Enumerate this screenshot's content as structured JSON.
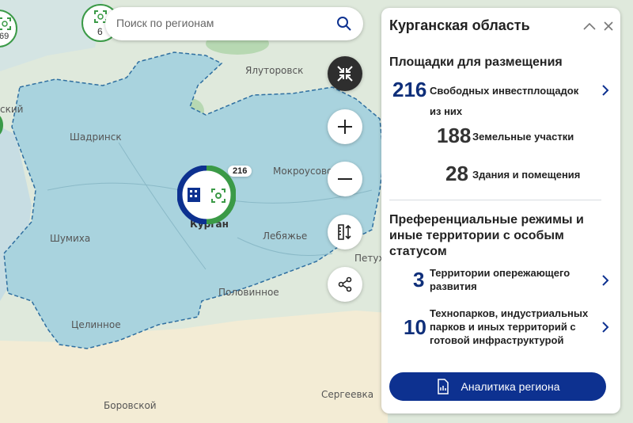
{
  "search": {
    "placeholder": "Поиск по регионам"
  },
  "map": {
    "cities": [
      "Ялуторовск",
      "Шадринск",
      "Мокроусово",
      "Курган",
      "Шумиха",
      "Лебяжье",
      "Петух",
      "Половинное",
      "Целинное",
      "Сергеевка",
      "Боровской",
      "ский"
    ],
    "clusters": [
      {
        "count": "6"
      },
      {
        "count": "69"
      }
    ],
    "marker": {
      "count": "216"
    }
  },
  "panel": {
    "title": "Курганская область",
    "section1_title": "Площадки для размещения",
    "free_count": "216",
    "free_label": "Свободных инвестплощадок",
    "of_them": "из них",
    "land_count": "188",
    "land_label": "Земельные участки",
    "buildings_count": "28",
    "buildings_label": "Здания и помещения",
    "section2_title": "Преференциальные режимы и иные территории с особым статусом",
    "tor_count": "3",
    "tor_label": "Территории опережающего развития",
    "parks_count": "10",
    "parks_label": "Технопарков, индустриальных парков и иных территорий с готовой инфраструктурой",
    "button_label": "Аналитика региона"
  },
  "colors": {
    "region_fill": "#a9d3de",
    "accent": "#0d3190",
    "green": "#3b9a47",
    "land": "#dfe9dc",
    "south": "#f3ecd5"
  }
}
